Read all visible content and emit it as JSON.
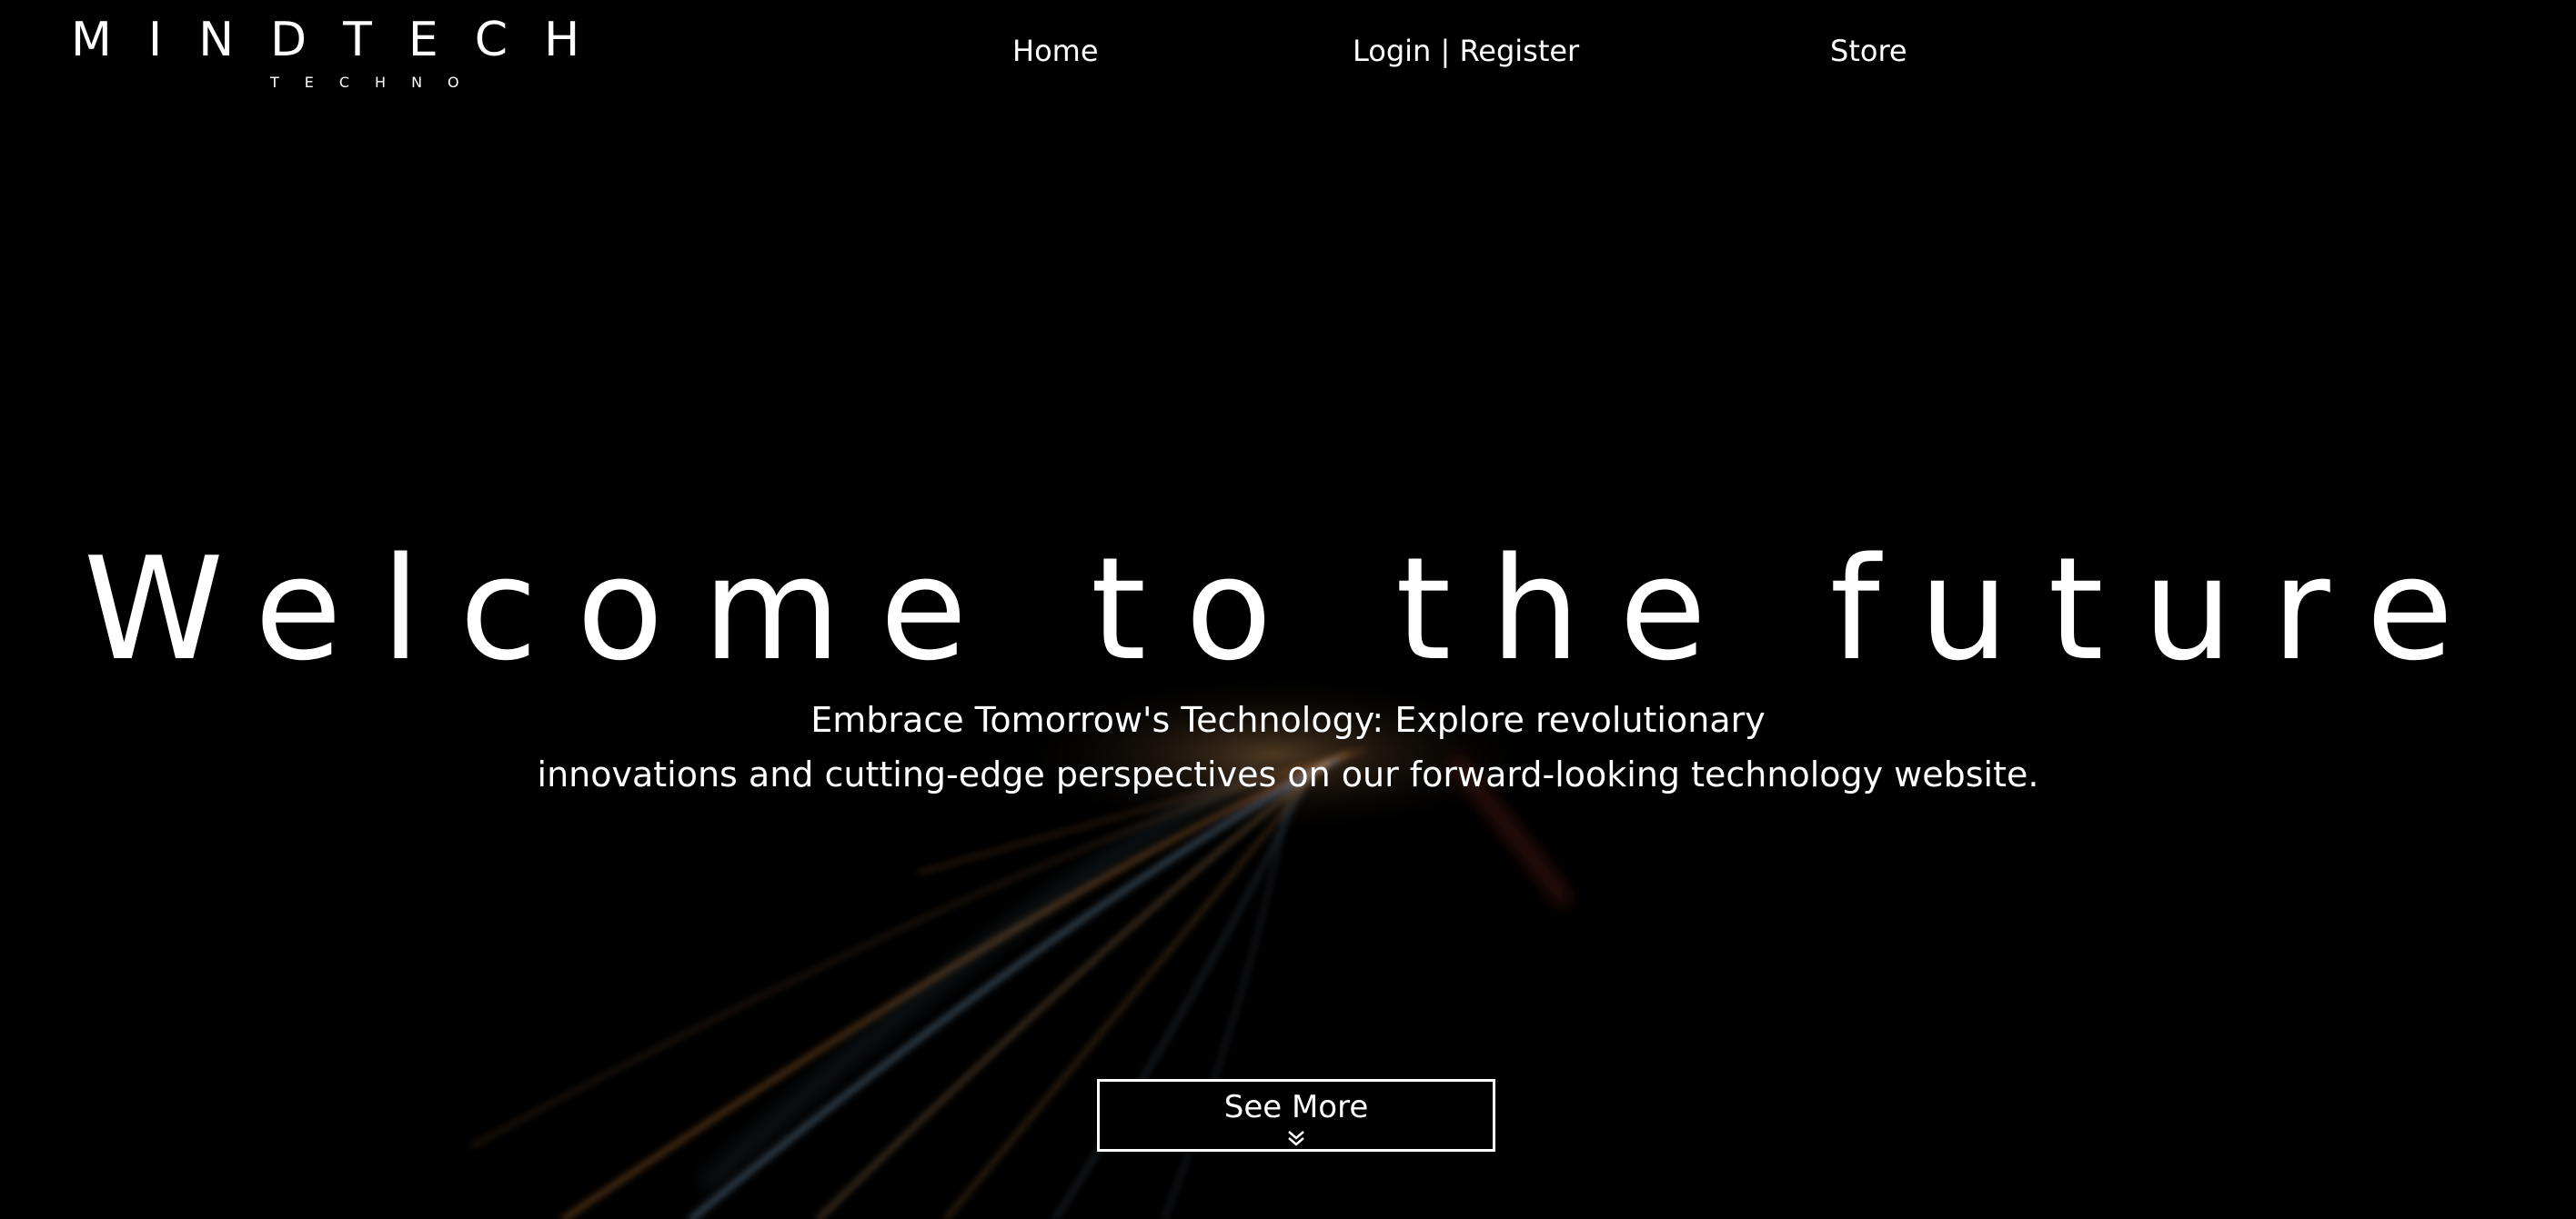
{
  "colors": {
    "background": "#000000",
    "text": "#ffffff",
    "trail_orange": "#d9853a",
    "trail_blue": "#7fa6c9",
    "trail_red": "#b83a2a"
  },
  "header": {
    "logo": {
      "name": "MINDTECH",
      "tagline": "TECHNO"
    },
    "nav": {
      "home": "Home",
      "login_register": "Login | Register",
      "store": "Store"
    }
  },
  "hero": {
    "title": "Welcome to the future",
    "subtitle_line1": "Embrace Tomorrow's Technology: Explore revolutionary",
    "subtitle_line2": "innovations and cutting-edge perspectives on our forward-looking technology website.",
    "see_more_label": "See More",
    "see_more_icon": "double-chevron-down-icon",
    "background_image": "light-trails"
  }
}
